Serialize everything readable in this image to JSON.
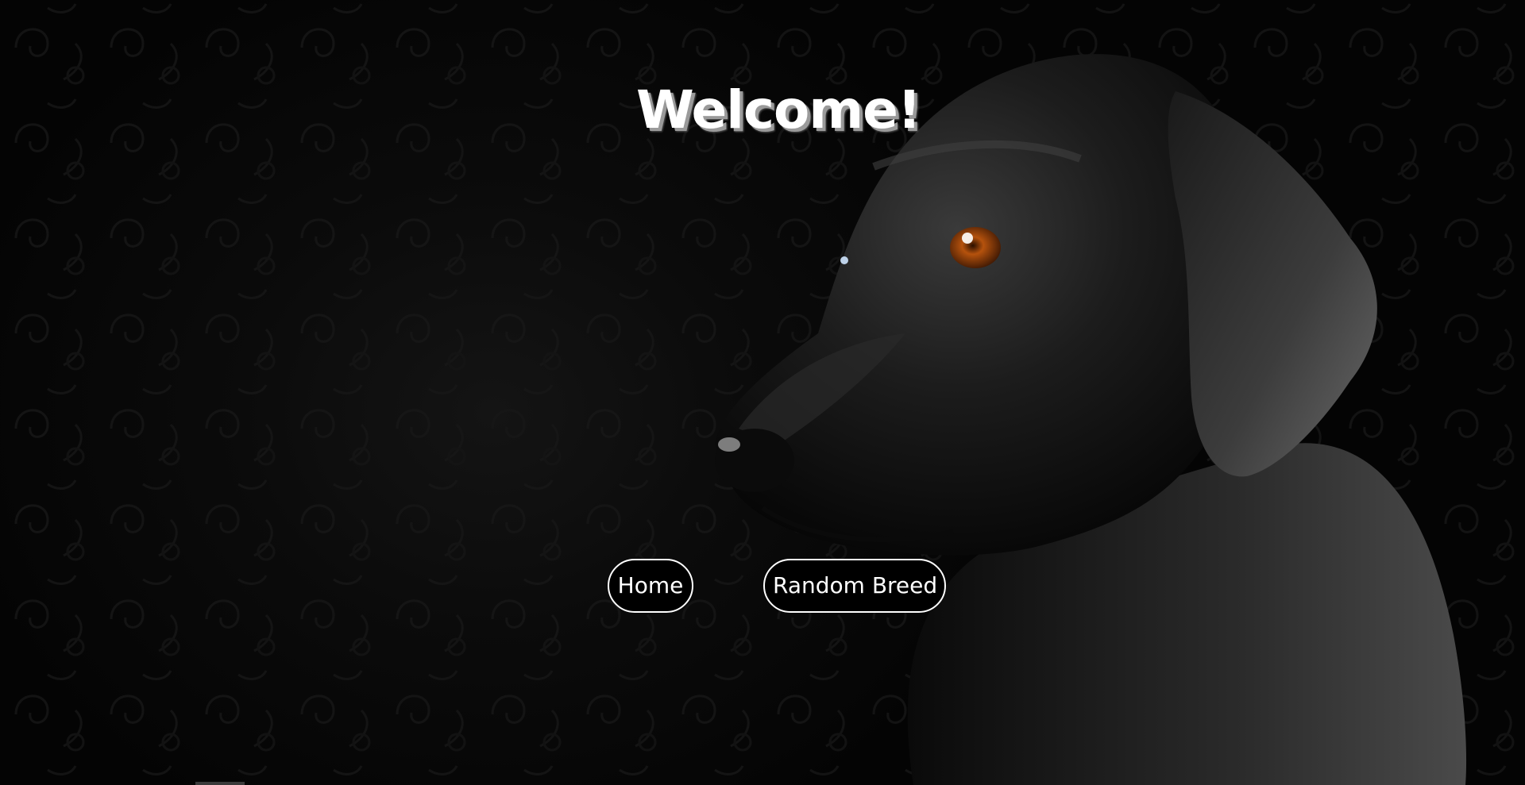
{
  "page": {
    "title": "Welcome!"
  },
  "nav": {
    "home_label": "Home",
    "random_breed_label": "Random Breed"
  },
  "colors": {
    "background": "#060606",
    "text": "#ffffff",
    "button_bg": "#000000",
    "button_border": "#ffffff",
    "dog_eye": "#b5520d"
  },
  "icons": {
    "hero_image": "black-labrador-dog-photo"
  }
}
